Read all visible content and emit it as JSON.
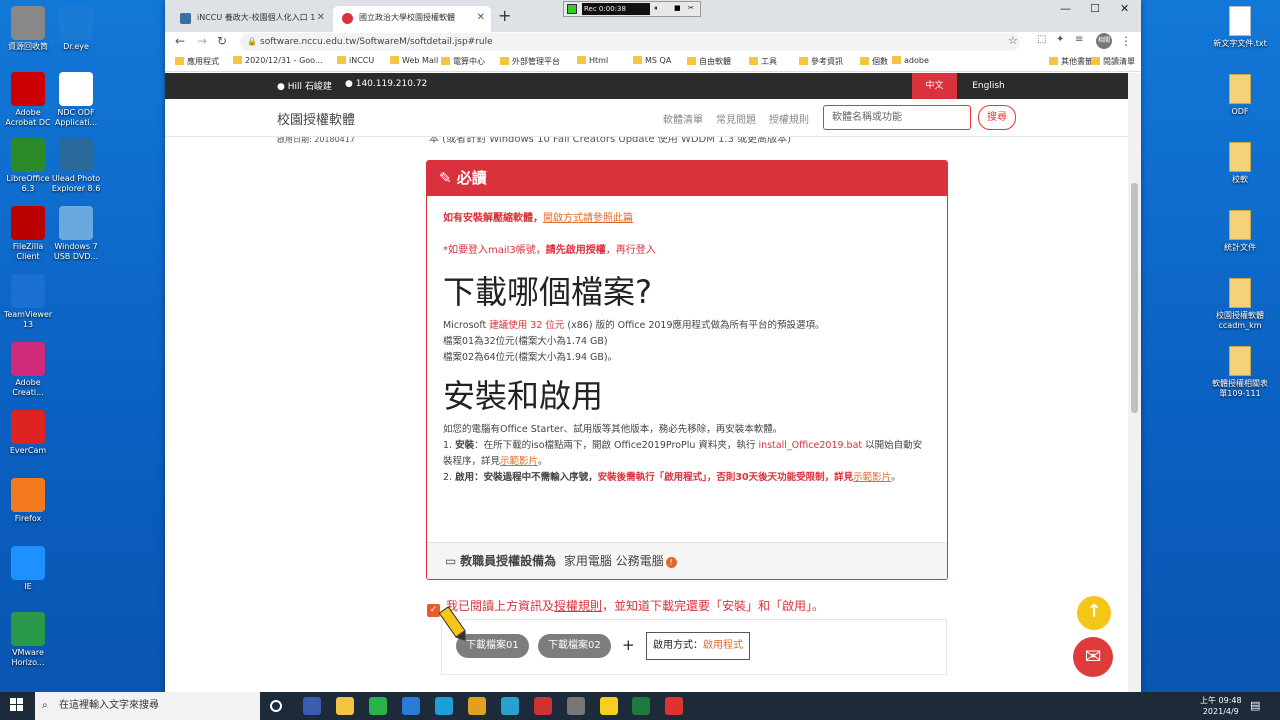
{
  "desktop": {
    "left_icons": [
      "資源回收筒",
      "Dr.eye",
      "Adobe Acrobat DC",
      "NDC ODF Applicati...",
      "LibreOffice 6.3",
      "Ulead Photo Explorer 8.6",
      "FileZilla Client",
      "Windows 7 USB DVD...",
      "TeamViewer 13",
      "Adobe Creati...",
      "EverCam",
      "Firefox",
      "IE",
      "VMware Horizo..."
    ],
    "right_icons": [
      "新文字文件.txt",
      "ODF",
      "校軟",
      "統計文件",
      "校園授權軟體ccadm_km",
      "軟體授權相關表單109-111"
    ]
  },
  "browser": {
    "tabs": [
      {
        "label": "iNCCU 養政大-校園個人化入口 1",
        "active": false
      },
      {
        "label": "國立政治大學校園授權軟體",
        "active": true
      }
    ],
    "new_tab": "+",
    "url": "software.nccu.edu.tw/SoftwareM/softdetail.jsp#rule",
    "bookmarks": [
      "應用程式",
      "2020/12/31 - Goo...",
      "iNCCU",
      "Web Mail",
      "電算中心",
      "外部管理平台",
      "Html",
      "MS QA",
      "自由軟體",
      "工具",
      "參考資訊",
      "個數",
      "adobe",
      "其他書籤",
      "閱讀清單"
    ],
    "profile": "相關"
  },
  "recorder": {
    "label": "Rec 0:00:38"
  },
  "site": {
    "user": "Hill 石峻建",
    "ip": "140.119.210.72",
    "lang_zh": "中文",
    "lang_en": "English",
    "brand": "校園授權軟體",
    "nav": [
      "軟體清單",
      "常見問題",
      "授權規則"
    ],
    "search_placeholder": "軟體名稱或功能",
    "search_btn": "搜尋",
    "cutoff_left": "啟用日期: 20180417",
    "cutoff_text": "本 (或者針對 Windows 10 Fall Creators Update 使用 WDDM 1.3 或更高版本)"
  },
  "panel": {
    "title": "必讀",
    "line1_a": "如有安裝解壓縮軟體，",
    "line1_b": "開啟方式請參照此篇",
    "line2_a": "*如要登入mail3帳號，",
    "line2_b": "請先啟用授權",
    "line2_c": "，再行登入",
    "h_download": "下載哪個檔案?",
    "p1_a": "Microsoft ",
    "p1_b": "建議使用 32 位元",
    "p1_c": " (x86) 版的 Office 2019應用程式做為所有平台的預設選項。",
    "p2": "檔案01為32位元(檔案大小為1.74 GB)",
    "p3": "檔案02為64位元(檔案大小為1.94 GB)。",
    "h_install": "安裝和啟用",
    "i1": "如您的電腦有Office Starter、試用版等其他版本，務必先移除，再安裝本軟體。",
    "i2_a": "1. ",
    "i2_b": "安裝",
    "i2_c": "：在所下載的iso檔點兩下，開啟 Office2019ProPlu 資料夾，執行 ",
    "i2_d": "install_Office2019.bat",
    "i2_e": " 以開始自動安裝程序，詳見",
    "i2_f": "示範影片",
    "i2_g": "。",
    "i3_a": "2. ",
    "i3_b": "啟用",
    "i3_c": "：安裝過程中不需輸入序號，",
    "i3_d": "安裝後需執行「啟用程式」，否則30天後天功能受限制，詳見",
    "i3_e": "示範影片",
    "i3_f": "。",
    "foot_label": "教職員授權設備為",
    "foot_value": "家用電腦 公務電腦"
  },
  "agree": {
    "text_a": "我已閱讀上方資訊及",
    "text_b": "授權規則",
    "text_c": "，並知道下載完還要「安裝」和「啟用」。"
  },
  "download": {
    "btn1": "下載檔案01",
    "btn2": "下載檔案02",
    "plus": "+",
    "act_label": "啟用方式：",
    "act_link": "啟用程式"
  },
  "taskbar": {
    "search": "在這裡輸入文字來搜尋",
    "time": "上午 09:48",
    "date": "2021/4/9"
  },
  "colors": {
    "accent": "#d9323c",
    "link": "#e06a2c",
    "topbar": "#2b2b2b"
  }
}
